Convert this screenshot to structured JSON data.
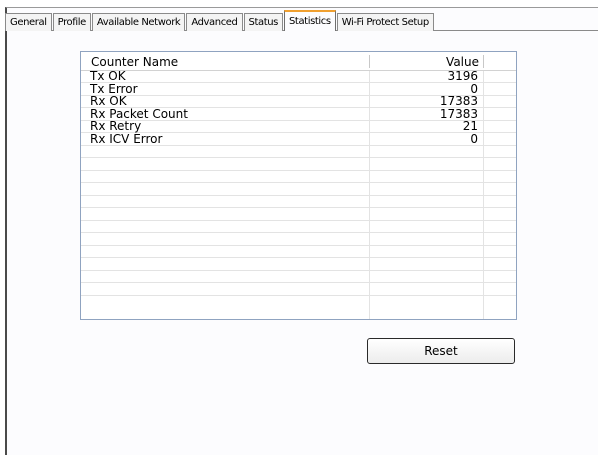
{
  "tabs": [
    {
      "label": "General",
      "active": false
    },
    {
      "label": "Profile",
      "active": false
    },
    {
      "label": "Available Network",
      "active": false
    },
    {
      "label": "Advanced",
      "active": false
    },
    {
      "label": "Status",
      "active": false
    },
    {
      "label": "Statistics",
      "active": true
    },
    {
      "label": "Wi-Fi Protect Setup",
      "active": false
    }
  ],
  "table": {
    "columns": {
      "name": "Counter Name",
      "value": "Value"
    },
    "rows": [
      {
        "name": "Tx OK",
        "value": "3196"
      },
      {
        "name": "Tx Error",
        "value": "0"
      },
      {
        "name": "Rx OK",
        "value": "17383"
      },
      {
        "name": "Rx Packet Count",
        "value": "17383"
      },
      {
        "name": "Rx Retry",
        "value": "21"
      },
      {
        "name": "Rx ICV Error",
        "value": "0"
      }
    ],
    "empty_rows": 12
  },
  "reset_button": {
    "label": "Reset"
  },
  "colors": {
    "active_tab_accent": "#f0a030",
    "panel_border": "#8fa3c0"
  }
}
